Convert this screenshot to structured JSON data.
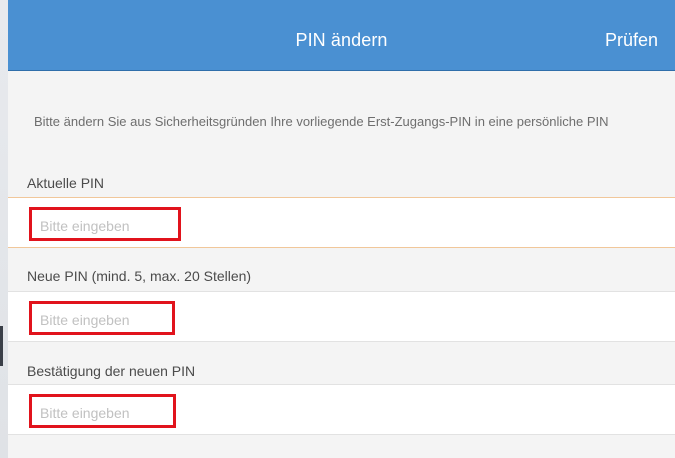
{
  "header": {
    "title": "PIN ändern",
    "action_label": "Prüfen",
    "background_color": "#4a90d2"
  },
  "intro": {
    "text": "Bitte ändern Sie aus Sicherheitsgründen Ihre vorliegende Erst-Zugangs-PIN in eine persönliche PIN"
  },
  "fields": [
    {
      "label": "Aktuelle PIN",
      "placeholder": "Bitte eingeben",
      "value": ""
    },
    {
      "label": "Neue PIN (mind. 5, max. 20 Stellen)",
      "placeholder": "Bitte eingeben",
      "value": ""
    },
    {
      "label": "Bestätigung der neuen PIN",
      "placeholder": "Bitte eingeben",
      "value": ""
    }
  ],
  "colors": {
    "highlight_border": "#e1131c",
    "active_divider": "#f1c79a"
  }
}
